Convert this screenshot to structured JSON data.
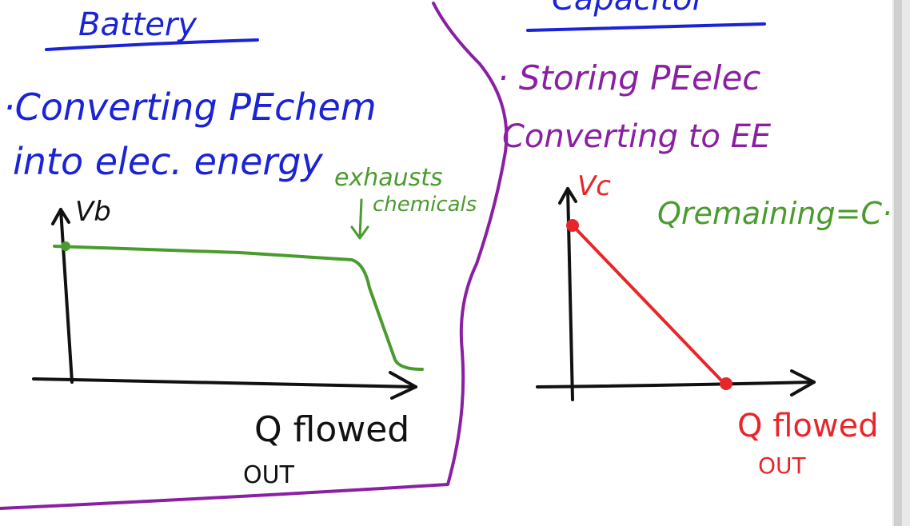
{
  "left_panel": {
    "heading": "Battery",
    "line1": "·Converting PEchem",
    "line2": "into elec. energy",
    "graph": {
      "y_label": "Vb",
      "annotation_top": "exhausts",
      "annotation_bottom": "chemicals",
      "x_label": "Q flowed",
      "x_label_sub": "OUT"
    }
  },
  "right_panel": {
    "heading": "Capacitor",
    "line1": "· Storing PEelec",
    "line2": "Converting to EE",
    "graph": {
      "y_label": "Vc",
      "formula": "Qremaining=C·V",
      "x_label": "Q flowed",
      "x_label_sub": "OUT"
    }
  },
  "colors": {
    "blue": "#1a23d6",
    "purple": "#8a1fa3",
    "green": "#4a9b2e",
    "red": "#e8262a",
    "black": "#111111"
  }
}
